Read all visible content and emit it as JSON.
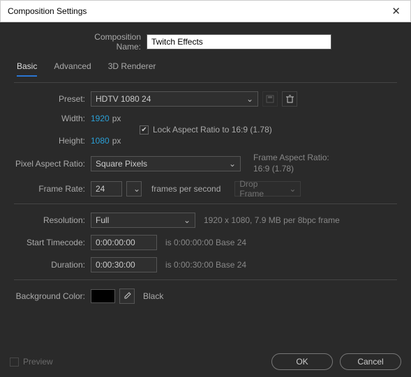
{
  "window": {
    "title": "Composition Settings"
  },
  "compName": {
    "label": "Composition Name:",
    "value": "Twitch Effects"
  },
  "tabs": {
    "basic": "Basic",
    "advanced": "Advanced",
    "renderer": "3D Renderer"
  },
  "preset": {
    "label": "Preset:",
    "value": "HDTV 1080 24"
  },
  "width": {
    "label": "Width:",
    "value": "1920",
    "unit": "px"
  },
  "height": {
    "label": "Height:",
    "value": "1080",
    "unit": "px"
  },
  "lockAspect": {
    "label": "Lock Aspect Ratio to 16:9 (1.78)",
    "checked": true
  },
  "pixelAspect": {
    "label": "Pixel Aspect Ratio:",
    "value": "Square Pixels"
  },
  "frameAspect": {
    "title": "Frame Aspect Ratio:",
    "value": "16:9 (1.78)"
  },
  "frameRate": {
    "label": "Frame Rate:",
    "value": "24",
    "unit": "frames per second",
    "dropMode": "Drop Frame"
  },
  "resolution": {
    "label": "Resolution:",
    "value": "Full",
    "note": "1920 x 1080, 7.9 MB per 8bpc frame"
  },
  "startTC": {
    "label": "Start Timecode:",
    "value": "0:00:00:00",
    "note": "is 0:00:00:00  Base 24"
  },
  "duration": {
    "label": "Duration:",
    "value": "0:00:30:00",
    "note": "is 0:00:30:00  Base 24"
  },
  "bgColor": {
    "label": "Background Color:",
    "name": "Black"
  },
  "preview": {
    "label": "Preview"
  },
  "buttons": {
    "ok": "OK",
    "cancel": "Cancel"
  }
}
